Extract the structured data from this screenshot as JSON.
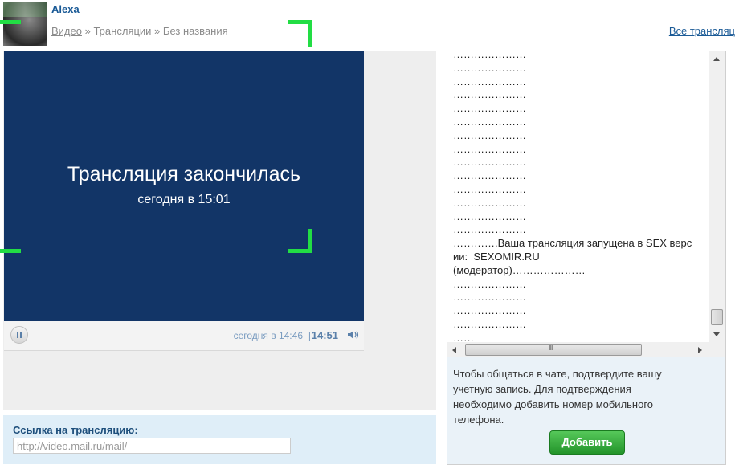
{
  "header": {
    "user_name": "Alexa",
    "breadcrumb": {
      "video_link": "Видео",
      "separator": "»",
      "streams": "Трансляции",
      "current": "Без названия"
    },
    "all_streams_link": "Все трансляц"
  },
  "player": {
    "ended_title": "Трансляция закончилась",
    "ended_time": "сегодня в 15:01",
    "start_time": "сегодня в 14:46",
    "time_separator": "|",
    "current_time": "14:51",
    "screen_color": "#123567"
  },
  "link_box": {
    "label": "Ссылка на трансляцию:",
    "url_value": "http://video.mail.ru/mail/"
  },
  "chat": {
    "lines": [
      "…………………",
      "…………………",
      "…………………",
      "…………………",
      "…………………",
      "…………………",
      "…………………",
      "…………………",
      "…………………",
      "…………………",
      "…………………",
      "…………………",
      "…………………",
      "…………………",
      "………….Ваша трансляция запущена в SEX версии:  SEXOMIR.RU",
      "(модератор)…………………",
      "…………………",
      "…………………",
      "…………………",
      "…………………",
      "……"
    ],
    "confirm_message": "Чтобы общаться в чате, подтвердите вашу учетную запись. Для подтверждения необходимо добавить номер мобильного телефона.",
    "add_button_label": "Добавить"
  },
  "colors": {
    "link": "#1a5a96",
    "bracket": "#22dd44",
    "button_green": "#2a9b30"
  }
}
